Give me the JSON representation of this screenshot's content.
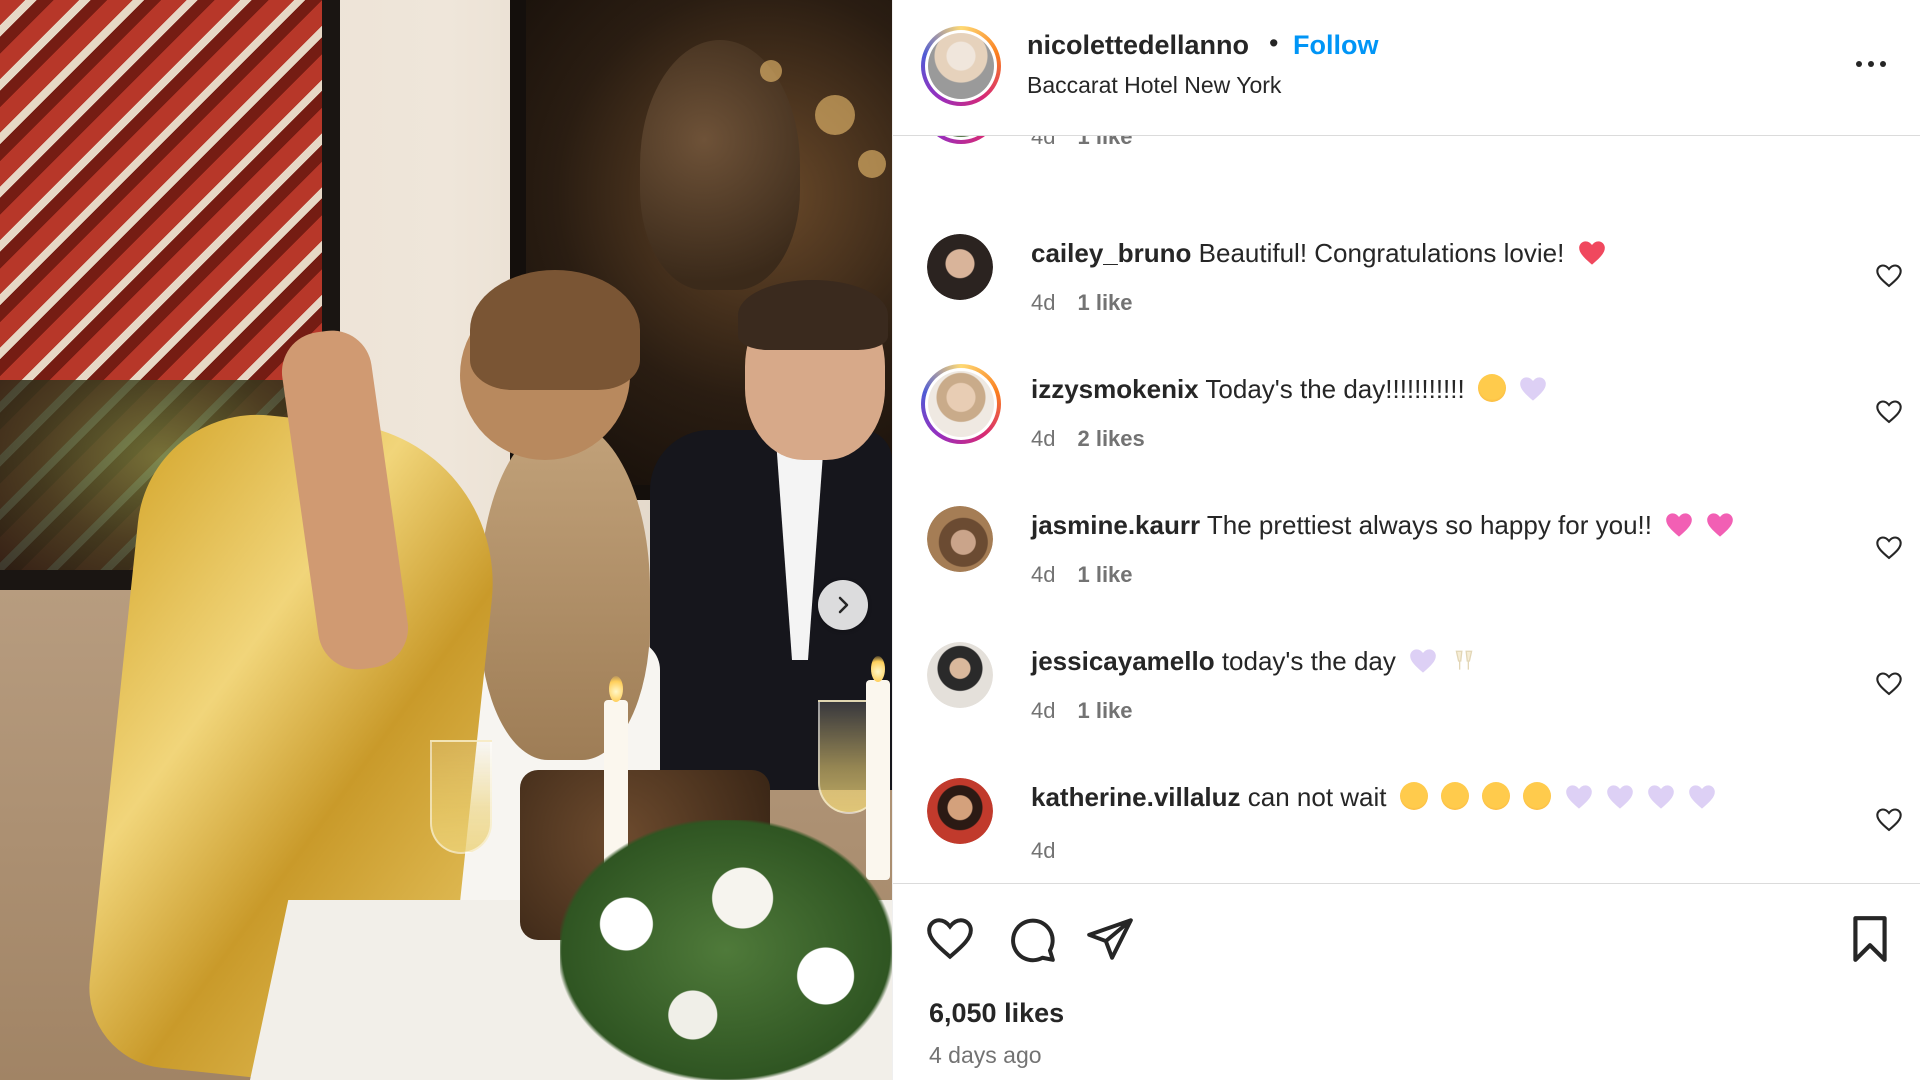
{
  "post": {
    "username": "nicolettedellanno",
    "separator": "•",
    "follow_label": "Follow",
    "location": "Baccarat Hotel New York"
  },
  "comments": [
    {
      "username": "",
      "text": "",
      "time": "4d",
      "likes": "1 like",
      "avatar_ring": true
    },
    {
      "username": "cailey_bruno",
      "text": "Beautiful! Congratulations lovie!",
      "emojis": [
        "heart-red"
      ],
      "time": "4d",
      "likes": "1 like",
      "avatar_ring": false
    },
    {
      "username": "izzysmokenix",
      "text": "Today's the day!!!!!!!!!!!",
      "emojis": [
        "face-hand-over-mouth",
        "heart-light-purple"
      ],
      "time": "4d",
      "likes": "2 likes",
      "avatar_ring": true
    },
    {
      "username": "jasmine.kaurr",
      "text": "The prettiest always so happy for you!!",
      "emojis": [
        "heart-pink",
        "heart-pink"
      ],
      "time": "4d",
      "likes": "1 like",
      "avatar_ring": false
    },
    {
      "username": "jessicayamello",
      "text": "today's the day",
      "emojis": [
        "heart-light-purple",
        "clinking-glasses"
      ],
      "time": "4d",
      "likes": "1 like",
      "avatar_ring": false
    },
    {
      "username": "katherine.villaluz",
      "text": "can not wait",
      "emojis": [
        "face-holding-back-tears",
        "face-holding-back-tears",
        "face-holding-back-tears",
        "face-holding-back-tears",
        "heart-light-purple",
        "heart-light-purple",
        "heart-light-purple",
        "heart-light-purple"
      ],
      "time": "4d",
      "likes": "",
      "avatar_ring": false
    }
  ],
  "actions": {
    "likes_count": "6,050 likes",
    "posted_ago": "4 days ago"
  },
  "icons": {
    "like": "heart-outline-icon",
    "comment": "comment-bubble-icon",
    "share": "paper-plane-icon",
    "save": "bookmark-icon",
    "more": "more-options-icon",
    "next": "chevron-right-icon"
  },
  "colors": {
    "follow": "#0095f6",
    "text": "#262626",
    "secondary": "#737373",
    "divider": "#dbdbdb"
  }
}
